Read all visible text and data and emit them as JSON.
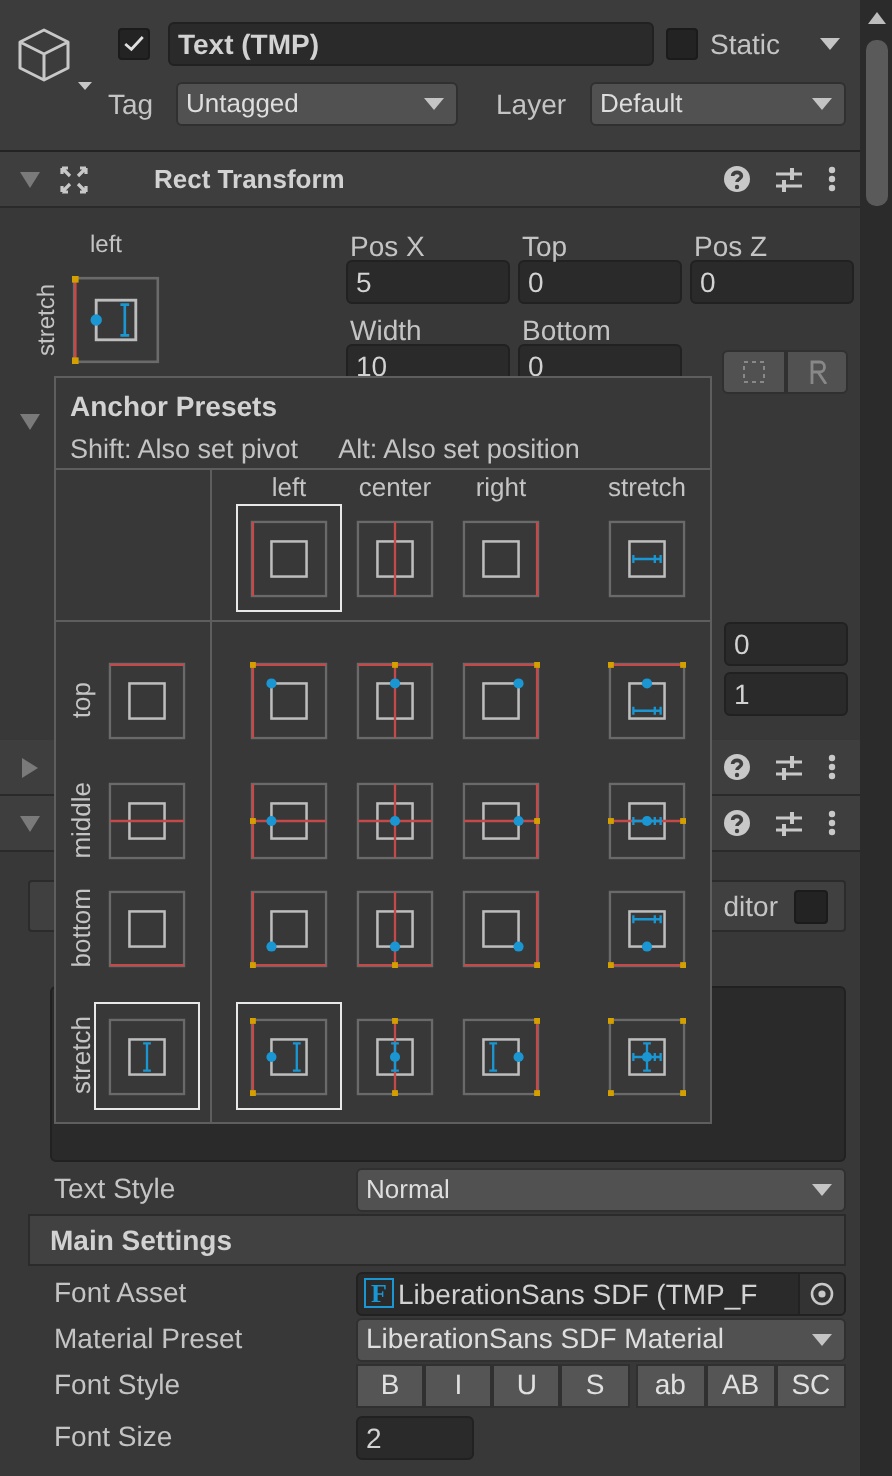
{
  "object": {
    "active": true,
    "name": "Text (TMP)",
    "static": false,
    "static_label": "Static",
    "tag_label": "Tag",
    "tag": "Untagged",
    "layer_label": "Layer",
    "layer": "Default"
  },
  "rect_transform": {
    "title": "Rect Transform",
    "expanded": true,
    "anchor_h": "left",
    "anchor_v": "stretch",
    "fields": [
      {
        "label": "Pos X",
        "value": "5"
      },
      {
        "label": "Top",
        "value": "0"
      },
      {
        "label": "Pos Z",
        "value": "0"
      },
      {
        "label": "Width",
        "value": "10"
      },
      {
        "label": "Bottom",
        "value": "0"
      }
    ],
    "section_expanded": true,
    "side_values": [
      "0",
      "1"
    ]
  },
  "components": [
    {
      "expanded": false
    },
    {
      "expanded": true
    }
  ],
  "editor_toggle": {
    "label": "ditor",
    "checked": false
  },
  "text_style": {
    "label": "Text Style",
    "value": "Normal"
  },
  "main_settings": "Main Settings",
  "font_asset": {
    "label": "Font Asset",
    "icon": "F",
    "value": "LiberationSans SDF (TMP_F"
  },
  "material_preset": {
    "label": "Material Preset",
    "value": "LiberationSans SDF Material"
  },
  "font_style": {
    "label": "Font Style",
    "buttons": [
      {
        "label": "B",
        "kind": "decoration",
        "selected": false
      },
      {
        "label": "I",
        "kind": "decoration",
        "selected": false
      },
      {
        "label": "U",
        "kind": "decoration",
        "selected": false
      },
      {
        "label": "S",
        "kind": "decoration",
        "selected": false
      },
      {
        "label": "ab",
        "kind": "case",
        "selected": false
      },
      {
        "label": "AB",
        "kind": "case",
        "selected": false
      },
      {
        "label": "SC",
        "kind": "case",
        "selected": false
      }
    ]
  },
  "font_size": {
    "label": "Font Size",
    "value": "2"
  },
  "popup": {
    "title": "Anchor Presets",
    "hint_shift": "Shift: Also set pivot",
    "hint_alt": "Alt: Also set position",
    "columns": [
      {
        "label": "left",
        "selected": true
      },
      {
        "label": "center",
        "selected": false
      },
      {
        "label": "right",
        "selected": false
      },
      {
        "label": "stretch",
        "selected": false
      }
    ],
    "rows": [
      {
        "label": "top",
        "selected": false,
        "cells": [
          {
            "selected": false
          },
          {
            "selected": false
          },
          {
            "selected": false
          },
          {
            "selected": false
          }
        ]
      },
      {
        "label": "middle",
        "selected": false,
        "cells": [
          {
            "selected": false
          },
          {
            "selected": false
          },
          {
            "selected": false
          },
          {
            "selected": false
          }
        ]
      },
      {
        "label": "bottom",
        "selected": false,
        "cells": [
          {
            "selected": false
          },
          {
            "selected": false
          },
          {
            "selected": false
          },
          {
            "selected": false
          }
        ]
      },
      {
        "label": "stretch",
        "selected": true,
        "cells": [
          {
            "selected": true
          },
          {
            "selected": false
          },
          {
            "selected": false
          },
          {
            "selected": false
          }
        ]
      }
    ]
  }
}
